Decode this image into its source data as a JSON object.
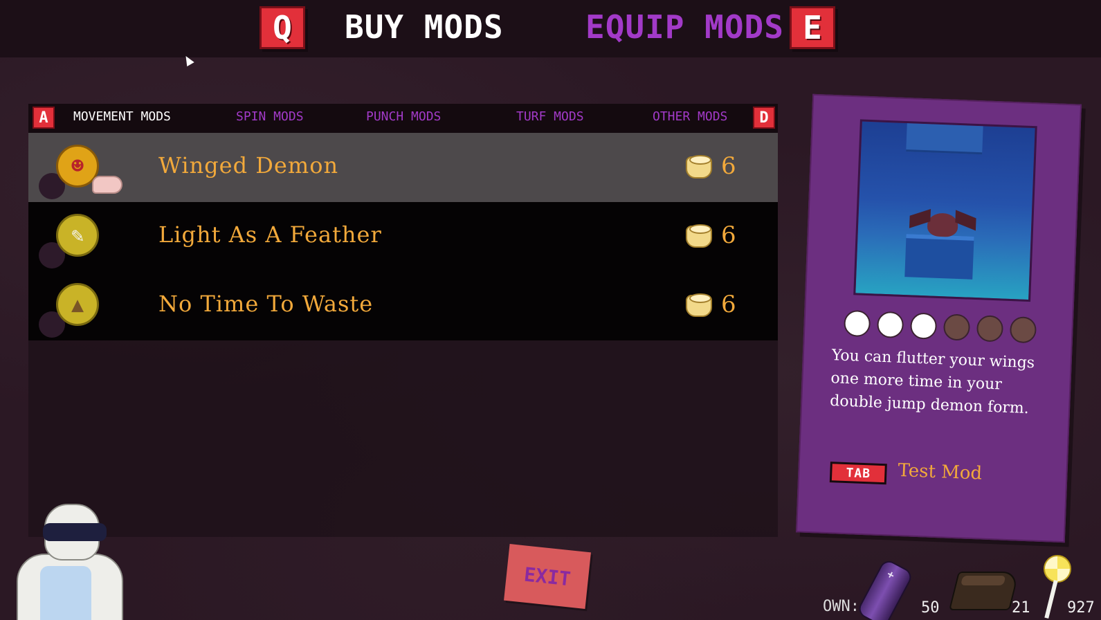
{
  "header": {
    "buy_key": "Q",
    "buy_label": "BUY MODS",
    "equip_label": "EQUIP MODS",
    "equip_key": "E"
  },
  "categories": {
    "prev_key": "A",
    "next_key": "D",
    "tabs": [
      "MOVEMENT MODS",
      "SPIN MODS",
      "PUNCH MODS",
      "TURF MODS",
      "OTHER MODS"
    ],
    "selected": "MOVEMENT MODS"
  },
  "mods": [
    {
      "name": "Winged Demon",
      "price": "6",
      "icon": "demon-face-icon",
      "selected": true
    },
    {
      "name": "Light As A Feather",
      "price": "6",
      "icon": "feather-icon",
      "selected": false
    },
    {
      "name": "No Time To Waste",
      "price": "6",
      "icon": "boot-icon",
      "selected": false
    }
  ],
  "detail": {
    "level_filled": 3,
    "level_total": 6,
    "description": "You can flutter your wings one more time in your double jump demon form.",
    "test_key": "TAB",
    "test_label": "Test Mod"
  },
  "exit_label": "EXIT",
  "currency": {
    "own_label": "OWN:",
    "battery_count": "50",
    "cake_count": "21",
    "candy_count": "927"
  },
  "colors": {
    "key_red": "#e2303a",
    "accent_purple": "#a23ac8",
    "mod_name_orange": "#f2a93b",
    "card_purple": "#6c2f80"
  }
}
